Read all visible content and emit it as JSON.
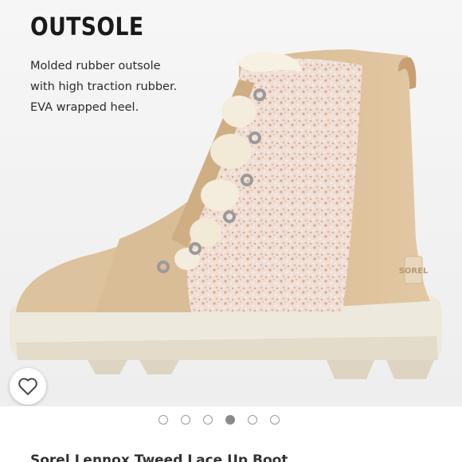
{
  "slide": {
    "title": "OUTSOLE",
    "description_lines": [
      "Molded rubber outsole",
      "with high traction rubber.",
      "EVA wrapped heel."
    ],
    "image": {
      "subject": "boot-image",
      "brand_tag": "SOREL"
    }
  },
  "like_button": {
    "icon": "heart-outline-icon"
  },
  "carousel": {
    "total": 6,
    "active_index": 3
  },
  "listing": {
    "title": "Sorel Lennox Tweed Lace Up Boot"
  },
  "colors": {
    "background": "#f1f1f1",
    "dot_active": "#8a8a8a",
    "dot_border": "#9a9a9a"
  }
}
